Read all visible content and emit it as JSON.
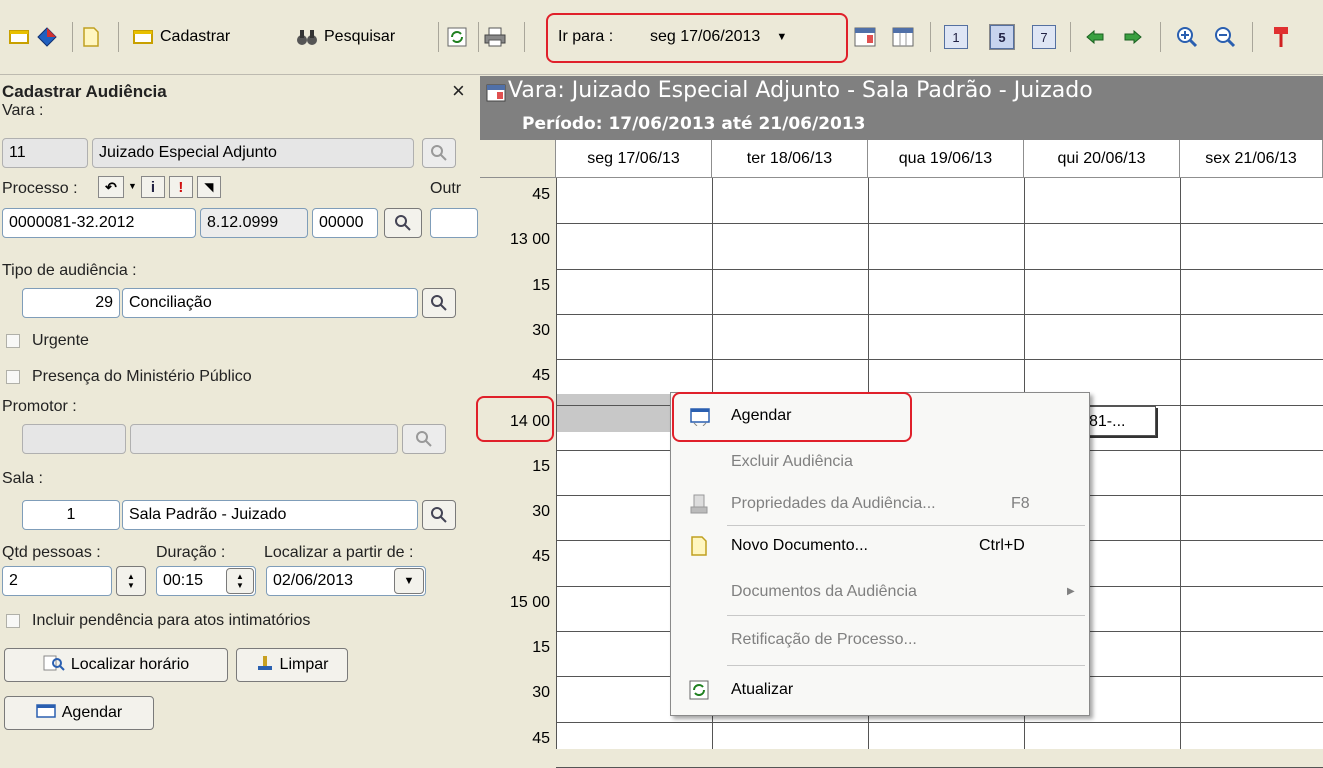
{
  "toolbar": {
    "cadastrar": "Cadastrar",
    "pesquisar": "Pesquisar",
    "ir_para_label": "Ir para :",
    "ir_para_value": "seg 17/06/2013",
    "view_day": "1",
    "view_workweek": "5",
    "view_week": "7"
  },
  "panel": {
    "title": "Cadastrar Audiência",
    "close": "×",
    "vara_label": "Vara :",
    "vara_code": "11",
    "vara_name": "Juizado Especial Adjunto",
    "processo_label": "Processo :",
    "outros_label": "Outr",
    "processo_num": "0000081-32.2012",
    "processo_part2": "8.12.0999",
    "processo_part3": "00000",
    "tipo_label": "Tipo de audiência :",
    "tipo_code": "29",
    "tipo_name": "Conciliação",
    "urgente": "Urgente",
    "presenca": "Presença do Ministério Público",
    "promotor_label": "Promotor :",
    "sala_label": "Sala :",
    "sala_code": "1",
    "sala_name": "Sala Padrão - Juizado",
    "qtd_label": "Qtd pessoas :",
    "duracao_label": "Duração :",
    "localizar_label": "Localizar a partir de :",
    "qtd_value": "2",
    "duracao_value": "00:15",
    "localizar_value": "02/06/2013",
    "incluir": "Incluir pendência para atos intimatórios",
    "btn_localizar": "Localizar horário",
    "btn_limpar": "Limpar",
    "btn_agendar": "Agendar"
  },
  "schedule": {
    "title": "Vara: Juizado Especial Adjunto - Sala Padrão - Juizado",
    "periodo": "Período: 17/06/2013 até 21/06/2013",
    "days": [
      "seg 17/06/13",
      "ter 18/06/13",
      "qua 19/06/13",
      "qui 20/06/13",
      "sex 21/06/13"
    ],
    "times": [
      "45",
      "13 00",
      "15",
      "30",
      "45",
      "14 00",
      "15",
      "30",
      "45",
      "15 00",
      "15",
      "30",
      "45"
    ],
    "appointment_text": "81-..."
  },
  "context_menu": {
    "agendar": "Agendar",
    "excluir": "Excluir Audiência",
    "propriedades": "Propriedades da Audiência...",
    "propriedades_shortcut": "F8",
    "novo_documento": "Novo Documento...",
    "novo_documento_shortcut": "Ctrl+D",
    "documentos": "Documentos da Audiência",
    "retificacao": "Retificação de Processo...",
    "atualizar": "Atualizar"
  }
}
